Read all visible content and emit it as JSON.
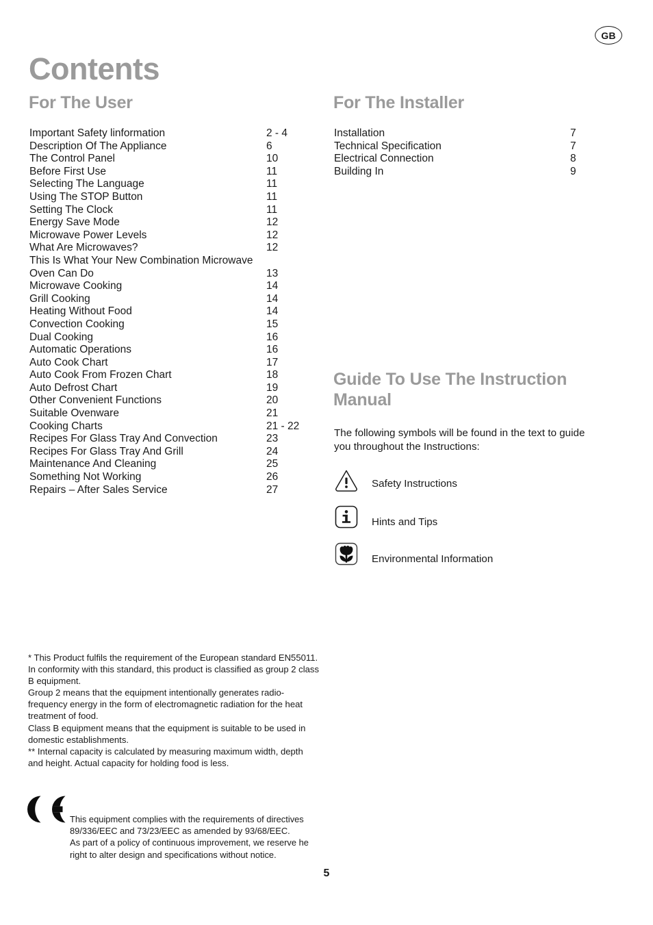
{
  "locale_badge": "GB",
  "title": "Contents",
  "sections": {
    "user_heading": "For The User",
    "installer_heading": "For The Installer",
    "guide_heading": "Guide To Use The Instruction Manual"
  },
  "user_toc": [
    {
      "label": "Important Safety linformation",
      "page": "2 - 4"
    },
    {
      "label": "Description Of The Appliance",
      "page": "6"
    },
    {
      "label": "The Control Panel",
      "page": "10"
    },
    {
      "label": "Before First Use",
      "page": "11"
    },
    {
      "label": "Selecting The Language",
      "page": "11"
    },
    {
      "label": "Using The STOP Button",
      "page": "11"
    },
    {
      "label": "Setting The Clock",
      "page": "11"
    },
    {
      "label": "Energy Save Mode",
      "page": "12"
    },
    {
      "label": "Microwave Power Levels",
      "page": "12"
    },
    {
      "label": "What Are Microwaves?",
      "page": "12"
    },
    {
      "label": "This Is What Your New Combination Microwave",
      "page": ""
    },
    {
      "label": "Oven Can Do",
      "page": "13"
    },
    {
      "label": "Microwave Cooking",
      "page": "14"
    },
    {
      "label": "Grill Cooking",
      "page": "14"
    },
    {
      "label": "Heating Without Food",
      "page": "14"
    },
    {
      "label": "Convection Cooking",
      "page": "15"
    },
    {
      "label": "Dual Cooking",
      "page": "16"
    },
    {
      "label": "Automatic Operations",
      "page": "16"
    },
    {
      "label": "Auto Cook Chart",
      "page": "17"
    },
    {
      "label": "Auto Cook From Frozen Chart",
      "page": "18"
    },
    {
      "label": "Auto Defrost Chart",
      "page": "19"
    },
    {
      "label": "Other Convenient Functions",
      "page": "20"
    },
    {
      "label": "Suitable Ovenware",
      "page": "21"
    },
    {
      "label": "Cooking Charts",
      "page": "21 - 22"
    },
    {
      "label": "Recipes For Glass Tray And Convection",
      "page": "23"
    },
    {
      "label": "Recipes For Glass Tray And Grill",
      "page": "24"
    },
    {
      "label": "Maintenance And Cleaning",
      "page": "25"
    },
    {
      "label": "Something Not Working",
      "page": "26"
    },
    {
      "label": "Repairs – After Sales Service",
      "page": "27"
    }
  ],
  "installer_toc": [
    {
      "label": "Installation",
      "page": "7"
    },
    {
      "label": "Technical Specification",
      "page": "7"
    },
    {
      "label": "Electrical Connection",
      "page": "8"
    },
    {
      "label": "Building In",
      "page": "9"
    }
  ],
  "guide_intro": "The following symbols will be found in the text to guide you throughout the Instructions:",
  "legend": [
    {
      "icon": "warning-triangle-icon",
      "label": "Safety Instructions"
    },
    {
      "icon": "info-icon",
      "label": "Hints and Tips"
    },
    {
      "icon": "environment-flower-icon",
      "label": "Environmental Information"
    }
  ],
  "footnotes": [
    "* This Product fulfils the requirement of the European standard EN55011.",
    "In conformity with this standard, this product is classified as group 2 class B equipment.",
    "Group 2 means that the equipment intentionally generates radio-frequency energy in the form of electromagnetic radiation for the heat treatment of food.",
    "Class B equipment means that the equipment is suitable to be used in domestic establishments.",
    "** Internal capacity is calculated by measuring maximum width, depth and height. Actual capacity for holding food is less."
  ],
  "ce": {
    "mark": "CE",
    "lines": [
      "This equipment complies with the requirements of directives 89/336/EEC and 73/23/EEC as amended by 93/68/EEC.",
      "As part of a policy of continuous improvement, we reserve he right to alter design and specifications without notice."
    ]
  },
  "page_number": "5"
}
